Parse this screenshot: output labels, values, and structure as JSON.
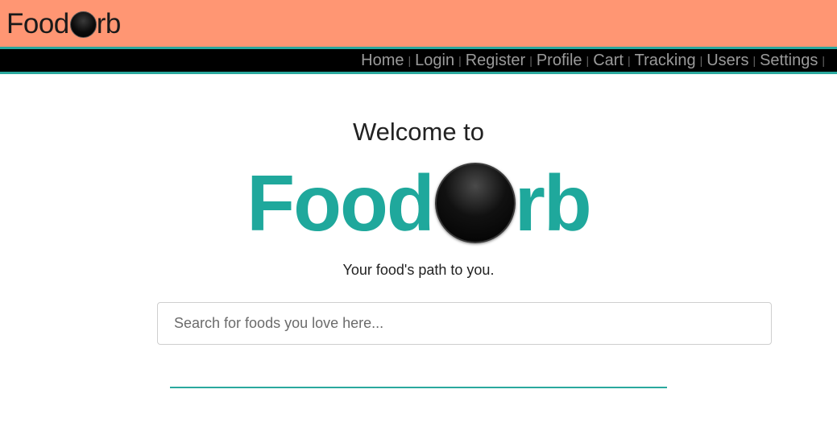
{
  "header": {
    "brand_prefix": "Food",
    "brand_suffix": "rb"
  },
  "nav": {
    "items": [
      {
        "label": "Home"
      },
      {
        "label": "Login"
      },
      {
        "label": "Register"
      },
      {
        "label": "Profile"
      },
      {
        "label": "Cart"
      },
      {
        "label": "Tracking"
      },
      {
        "label": "Users"
      },
      {
        "label": "Settings"
      }
    ],
    "separator": "|"
  },
  "hero": {
    "welcome": "Welcome to",
    "brand_prefix": "Food",
    "brand_suffix": "rb",
    "tagline": "Your food's path to you."
  },
  "search": {
    "placeholder": "Search for foods you love here...",
    "value": ""
  },
  "colors": {
    "header_bg": "#ff9673",
    "accent": "#1fa89c",
    "nav_bg": "#000000",
    "nav_text": "#9a9a9a"
  }
}
